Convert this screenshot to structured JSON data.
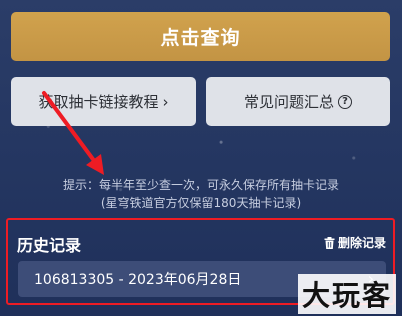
{
  "query_button": {
    "label": "点击查询"
  },
  "tutorial_button": {
    "label": "获取抽卡链接教程",
    "chevron": "›"
  },
  "faq_button": {
    "label": "常见问题汇总",
    "icon": "?"
  },
  "tips": {
    "line1": "提示：每半年至少查一次，可永久保存所有抽卡记录",
    "line2": "(星穹铁道官方仅保留180天抽卡记录)"
  },
  "history": {
    "title": "历史记录",
    "clear_label": "删除记录",
    "records": [
      {
        "text": "106813305 - 2023年06月28日"
      }
    ]
  },
  "watermark": {
    "text": "大玩客"
  },
  "colors": {
    "accent": "#c99a48",
    "highlight": "#ee1c24",
    "background": "#273a64"
  }
}
